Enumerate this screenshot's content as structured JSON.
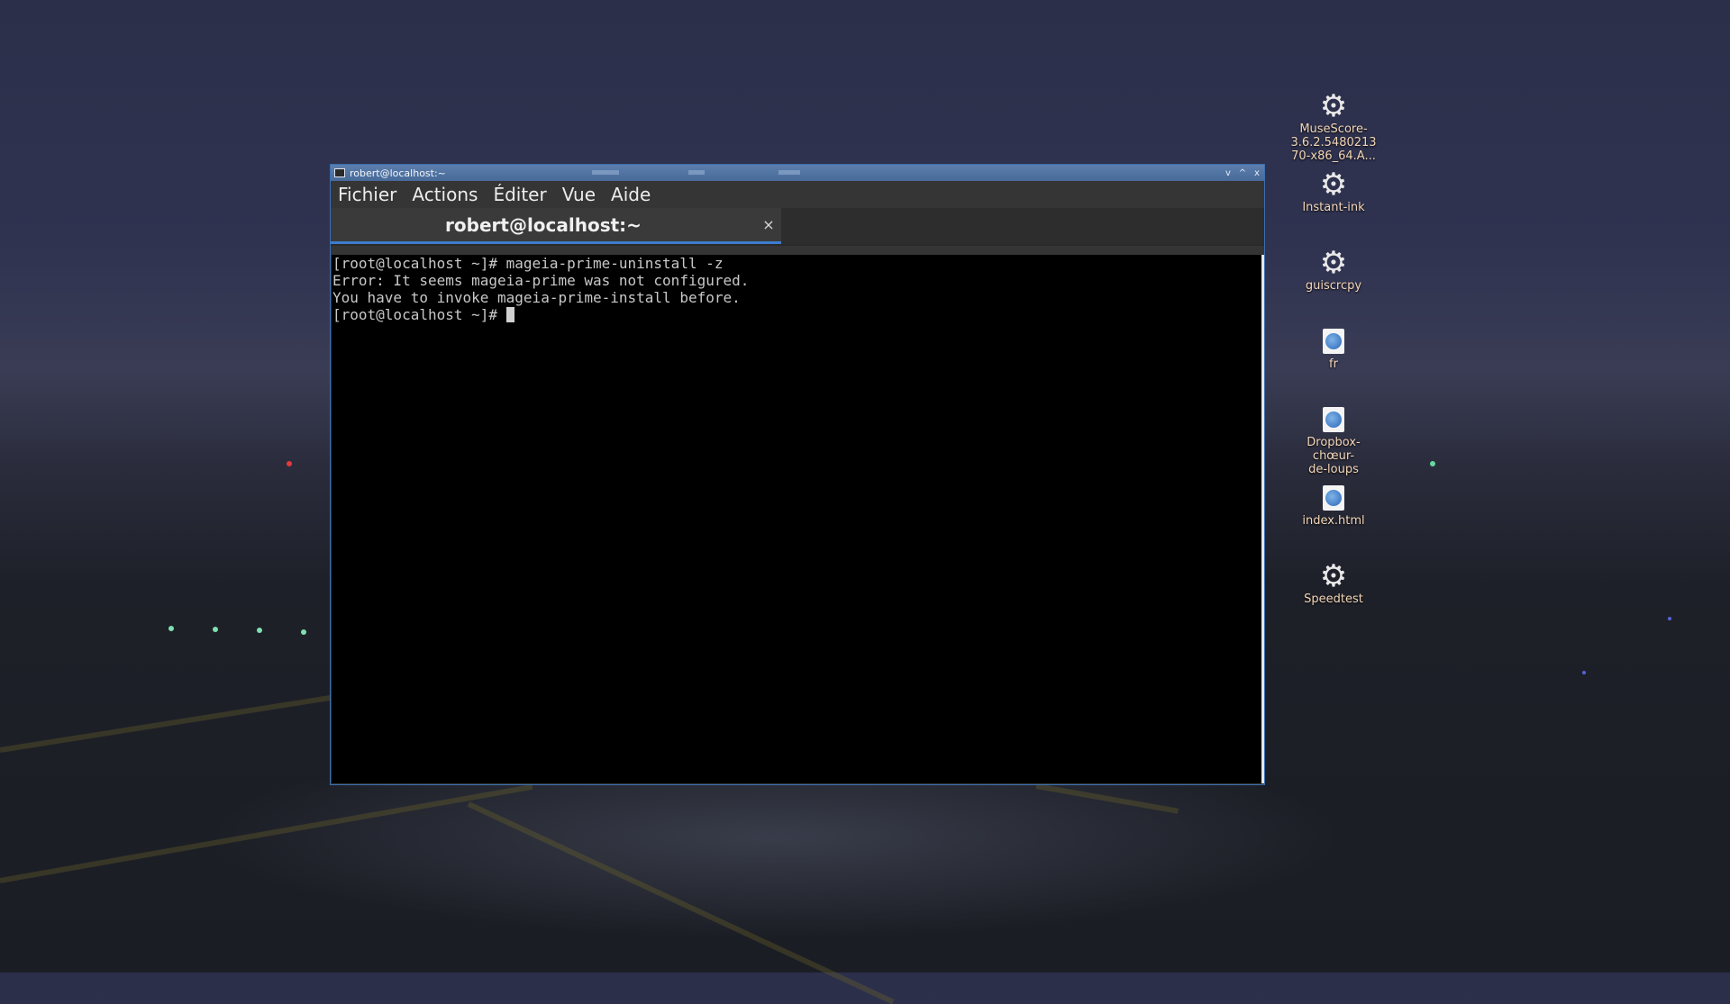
{
  "window": {
    "title": "robert@localhost:~",
    "controls": [
      "v",
      "^",
      "x"
    ]
  },
  "menu": [
    "Fichier",
    "Actions",
    "Éditer",
    "Vue",
    "Aide"
  ],
  "tab": {
    "label": "robert@localhost:~",
    "close": "×"
  },
  "terminal": {
    "lines": [
      "[root@localhost ~]# mageia-prime-uninstall -z",
      "Error: It seems mageia-prime was not configured.",
      "You have to invoke mageia-prime-install before.",
      "[root@localhost ~]# "
    ]
  },
  "desktop_icons": [
    {
      "label": "MuseScore-3.6.2.548021370-x86_64.A...",
      "icon": "gear-icon"
    },
    {
      "label": "Instant-ink",
      "icon": "gear-icon"
    },
    {
      "label": "guiscrcpy",
      "icon": "gear-icon"
    },
    {
      "label": "fr",
      "icon": "web-document-icon"
    },
    {
      "label": "Dropbox-chœur-de-loups",
      "icon": "web-document-icon"
    },
    {
      "label": "index.html",
      "icon": "web-document-icon"
    },
    {
      "label": "Speedtest",
      "icon": "gear-icon"
    }
  ]
}
